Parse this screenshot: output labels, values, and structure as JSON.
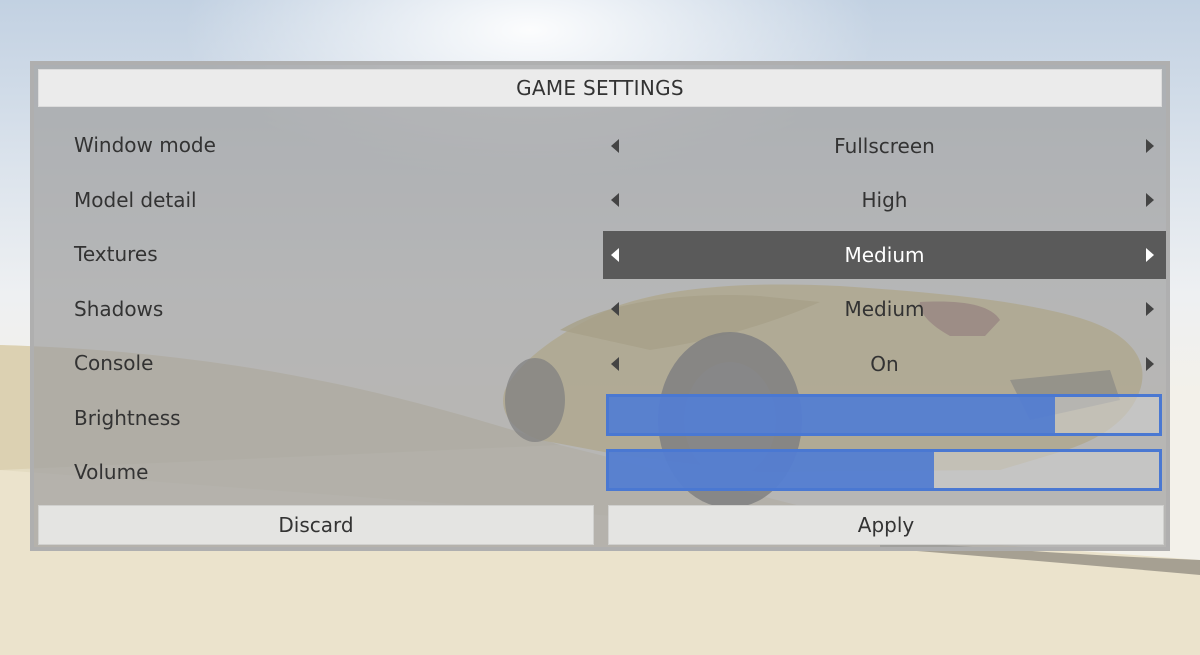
{
  "title": "GAME SETTINGS",
  "settings": [
    {
      "label": "Window mode",
      "value": "Fullscreen"
    },
    {
      "label": "Model detail",
      "value": "High"
    },
    {
      "label": "Textures",
      "value": "Medium",
      "selected": true
    },
    {
      "label": "Shadows",
      "value": "Medium"
    },
    {
      "label": "Console",
      "value": "On"
    }
  ],
  "sliders": [
    {
      "label": "Brightness",
      "level": 0.81
    },
    {
      "label": "Volume",
      "level": 0.59
    }
  ],
  "buttons": {
    "discard": "Discard",
    "apply": "Apply"
  },
  "colors": {
    "slider_accent": "#4a78d2",
    "selected_row": "#5a5a5a",
    "panel": "#a0a0a0"
  }
}
